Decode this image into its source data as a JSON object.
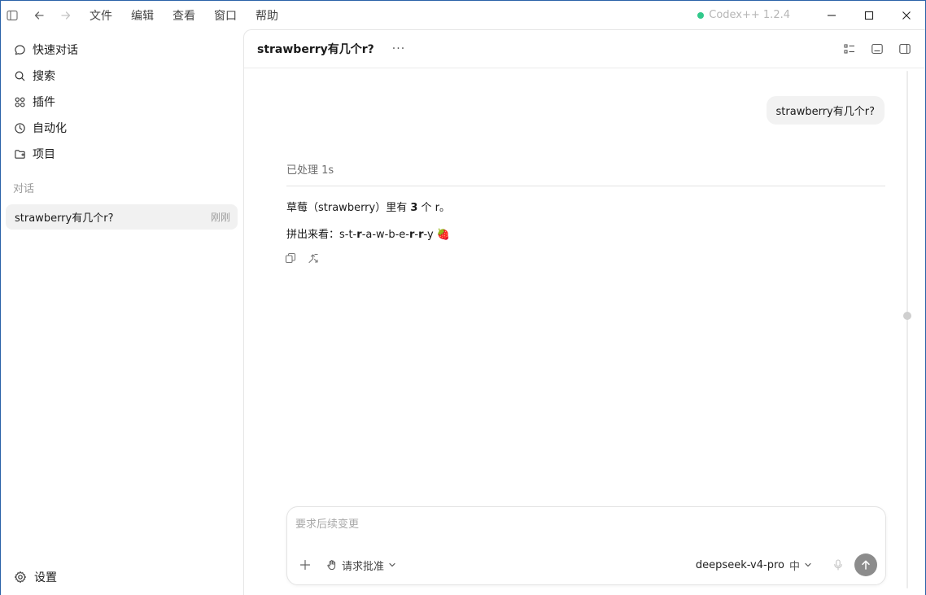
{
  "menu": [
    "文件",
    "编辑",
    "查看",
    "窗口",
    "帮助"
  ],
  "app_badge": "Codex++ 1.2.4",
  "colors": {
    "badge_dot": "#31c98b",
    "accent_border": "#2a62a8",
    "send_button": "#8c8c8c"
  },
  "sidebar": {
    "nav": [
      {
        "label": "快速对话",
        "icon": "chat-bubble-icon"
      },
      {
        "label": "搜索",
        "icon": "search-icon"
      },
      {
        "label": "插件",
        "icon": "plugins-icon"
      },
      {
        "label": "自动化",
        "icon": "clock-icon"
      },
      {
        "label": "项目",
        "icon": "folder-icon"
      }
    ],
    "section_label": "对话",
    "conversation": {
      "title": "strawberry有几个r?",
      "time": "刚刚"
    },
    "settings_label": "设置"
  },
  "header": {
    "title": "strawberry有几个r?",
    "more": "···"
  },
  "chat": {
    "user_message": "strawberry有几个r?",
    "processed": "已处理 1s",
    "answer_line1_pre": "草莓（strawberry）里有 ",
    "answer_line1_bold": "3",
    "answer_line1_post": " 个 r。",
    "answer_line2_pre": "拼出来看：s-t-",
    "answer_r1": "r",
    "answer_line2_mid": "-a-w-b-e-",
    "answer_r2": "r",
    "answer_dash": "-",
    "answer_r3": "r",
    "answer_line2_post": "-y 🍓"
  },
  "composer": {
    "placeholder": "要求后续变更",
    "approval_label": "请求批准",
    "model": "deepseek-v4-pro",
    "effort": "中"
  }
}
